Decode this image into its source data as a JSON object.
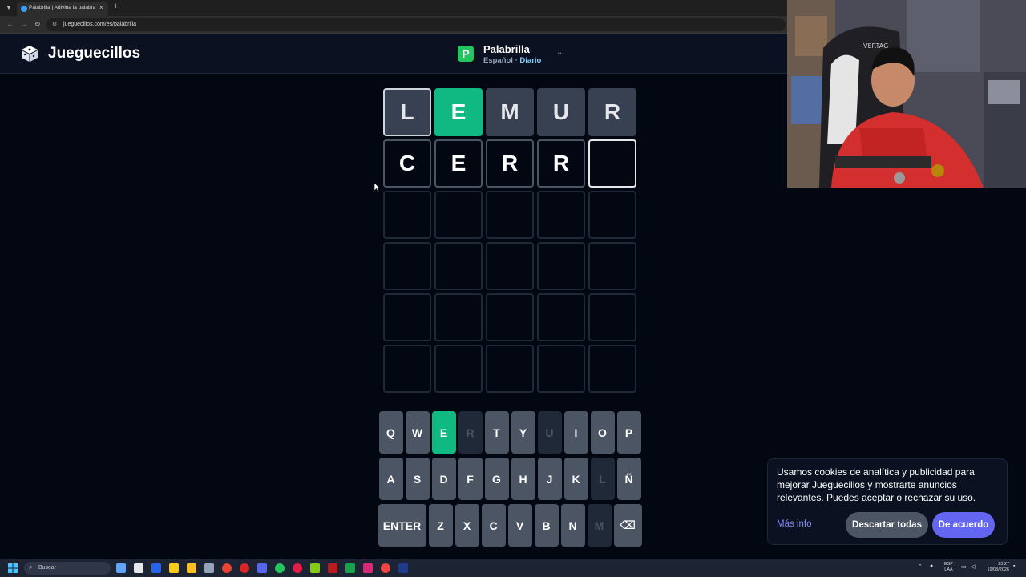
{
  "browser": {
    "tab_title": "Palabrilla | Adivina la palabra del día",
    "tab_close": "×",
    "new_tab": "+",
    "url": "jueguecillos.com/es/palabrilla"
  },
  "header": {
    "site_name": "Jueguecillos",
    "game_badge": "P",
    "game_name": "Palabrilla",
    "language": "Español",
    "separator": " · ",
    "mode": "Diario"
  },
  "board": {
    "rows": [
      [
        {
          "letter": "L",
          "state": "absent"
        },
        {
          "letter": "E",
          "state": "correct"
        },
        {
          "letter": "M",
          "state": "absent"
        },
        {
          "letter": "U",
          "state": "absent"
        },
        {
          "letter": "R",
          "state": "absent"
        }
      ],
      [
        {
          "letter": "C",
          "state": "filled"
        },
        {
          "letter": "E",
          "state": "filled"
        },
        {
          "letter": "R",
          "state": "filled"
        },
        {
          "letter": "R",
          "state": "filled"
        },
        {
          "letter": "",
          "state": "cursor"
        }
      ],
      [
        {
          "letter": "",
          "state": "empty"
        },
        {
          "letter": "",
          "state": "empty"
        },
        {
          "letter": "",
          "state": "empty"
        },
        {
          "letter": "",
          "state": "empty"
        },
        {
          "letter": "",
          "state": "empty"
        }
      ],
      [
        {
          "letter": "",
          "state": "empty"
        },
        {
          "letter": "",
          "state": "empty"
        },
        {
          "letter": "",
          "state": "empty"
        },
        {
          "letter": "",
          "state": "empty"
        },
        {
          "letter": "",
          "state": "empty"
        }
      ],
      [
        {
          "letter": "",
          "state": "empty"
        },
        {
          "letter": "",
          "state": "empty"
        },
        {
          "letter": "",
          "state": "empty"
        },
        {
          "letter": "",
          "state": "empty"
        },
        {
          "letter": "",
          "state": "empty"
        }
      ],
      [
        {
          "letter": "",
          "state": "empty"
        },
        {
          "letter": "",
          "state": "empty"
        },
        {
          "letter": "",
          "state": "empty"
        },
        {
          "letter": "",
          "state": "empty"
        },
        {
          "letter": "",
          "state": "empty"
        }
      ]
    ]
  },
  "keyboard": {
    "rows": [
      [
        {
          "key": "Q",
          "state": "unused"
        },
        {
          "key": "W",
          "state": "unused"
        },
        {
          "key": "E",
          "state": "correct"
        },
        {
          "key": "R",
          "state": "absent"
        },
        {
          "key": "T",
          "state": "unused"
        },
        {
          "key": "Y",
          "state": "unused"
        },
        {
          "key": "U",
          "state": "absent"
        },
        {
          "key": "I",
          "state": "unused"
        },
        {
          "key": "O",
          "state": "unused"
        },
        {
          "key": "P",
          "state": "unused"
        }
      ],
      [
        {
          "key": "A",
          "state": "unused"
        },
        {
          "key": "S",
          "state": "unused"
        },
        {
          "key": "D",
          "state": "unused"
        },
        {
          "key": "F",
          "state": "unused"
        },
        {
          "key": "G",
          "state": "unused"
        },
        {
          "key": "H",
          "state": "unused"
        },
        {
          "key": "J",
          "state": "unused"
        },
        {
          "key": "K",
          "state": "unused"
        },
        {
          "key": "L",
          "state": "absent"
        },
        {
          "key": "Ñ",
          "state": "unused"
        }
      ],
      [
        {
          "key": "ENTER",
          "state": "wide"
        },
        {
          "key": "Z",
          "state": "unused"
        },
        {
          "key": "X",
          "state": "unused"
        },
        {
          "key": "C",
          "state": "unused"
        },
        {
          "key": "V",
          "state": "unused"
        },
        {
          "key": "B",
          "state": "unused"
        },
        {
          "key": "N",
          "state": "unused"
        },
        {
          "key": "M",
          "state": "absent"
        },
        {
          "key": "⌫",
          "state": "back"
        }
      ]
    ]
  },
  "cookie": {
    "text": "Usamos cookies de analítica y publicidad para mejorar Jueguecillos y mostrarte anuncios relevantes. Puedes aceptar o rechazar su uso.",
    "more_info": "Más info",
    "reject": "Descartar todas",
    "accept": "De acuerdo"
  },
  "taskbar": {
    "search_placeholder": "Buscar",
    "lang_top": "ESP",
    "lang_bottom": "LAA",
    "time": "23:27",
    "date": "19/08/2026"
  },
  "colors": {
    "correct": "#10b981",
    "absent": "#374151",
    "background": "#030712",
    "accent": "#6366f1"
  }
}
